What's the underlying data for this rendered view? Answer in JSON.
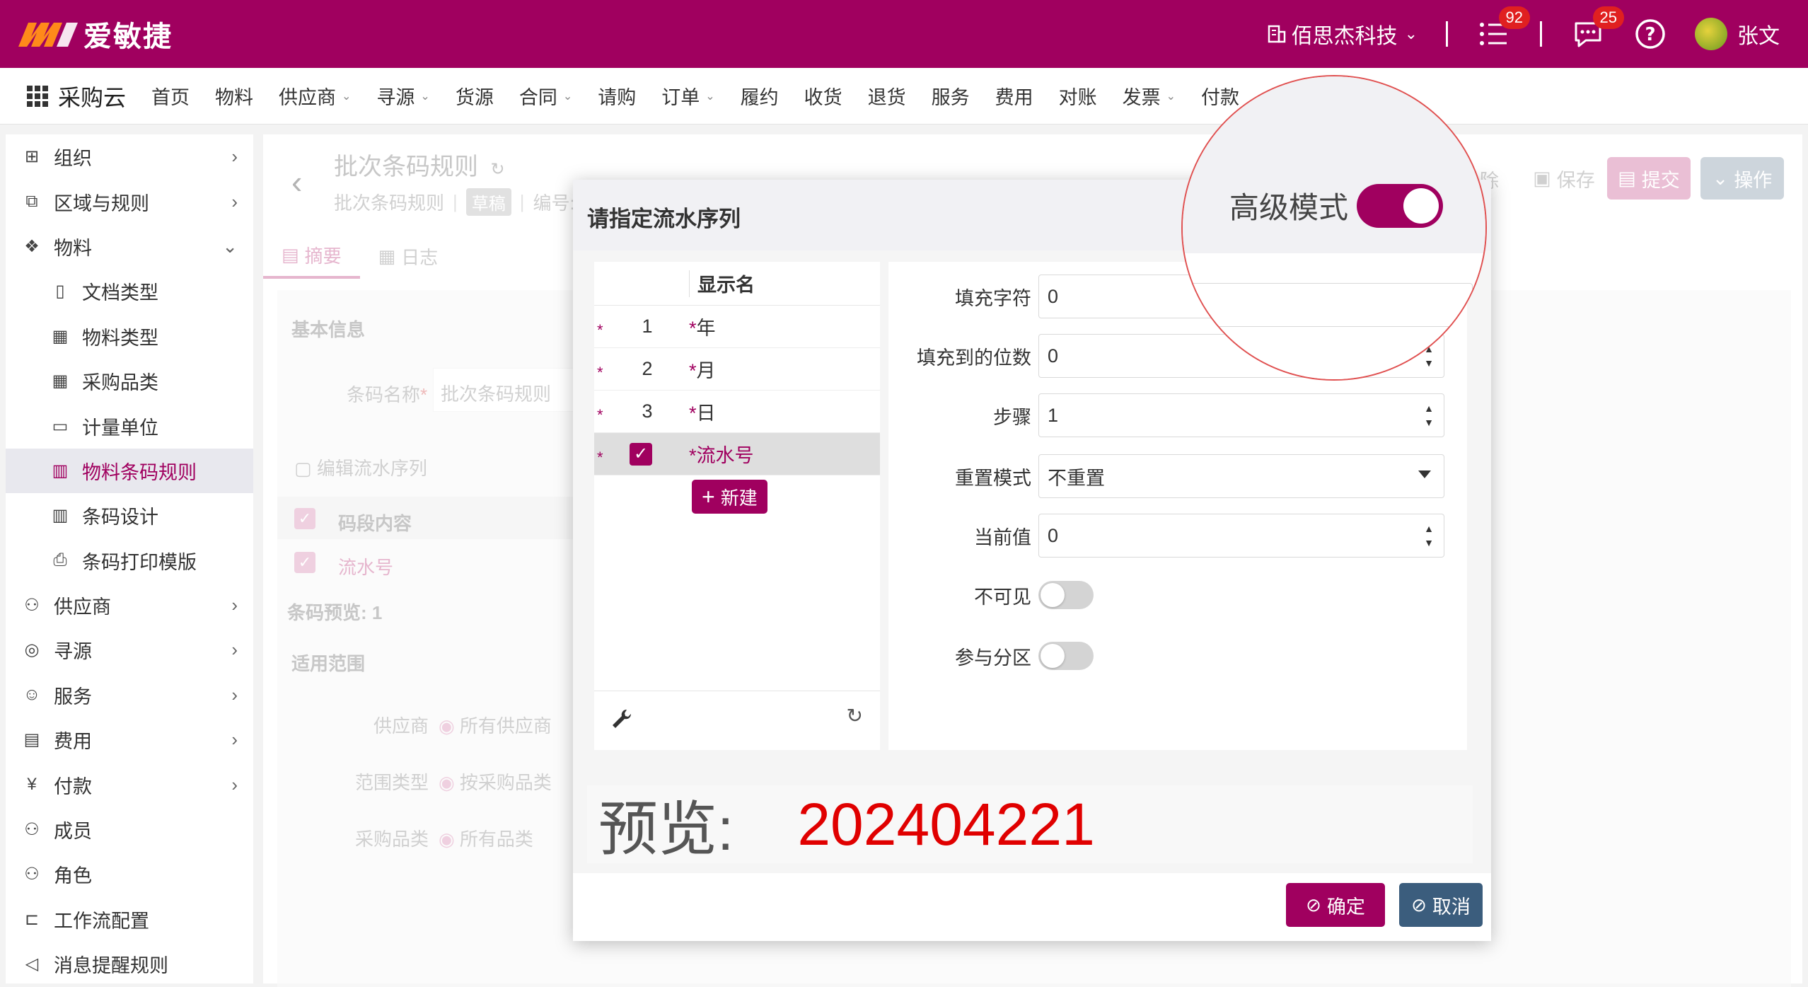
{
  "header": {
    "logo_text": "爱敏捷",
    "company": "佰思杰科技",
    "tasks_badge": "92",
    "messages_badge": "25",
    "user_name": "张文"
  },
  "nav": {
    "app_name": "采购云",
    "items": [
      {
        "label": "首页",
        "dropdown": false
      },
      {
        "label": "物料",
        "dropdown": false
      },
      {
        "label": "供应商",
        "dropdown": true
      },
      {
        "label": "寻源",
        "dropdown": true
      },
      {
        "label": "货源",
        "dropdown": false
      },
      {
        "label": "合同",
        "dropdown": true
      },
      {
        "label": "请购",
        "dropdown": false
      },
      {
        "label": "订单",
        "dropdown": true
      },
      {
        "label": "履约",
        "dropdown": false
      },
      {
        "label": "收货",
        "dropdown": false
      },
      {
        "label": "退货",
        "dropdown": false
      },
      {
        "label": "服务",
        "dropdown": false
      },
      {
        "label": "费用",
        "dropdown": false
      },
      {
        "label": "对账",
        "dropdown": false
      },
      {
        "label": "发票",
        "dropdown": true
      },
      {
        "label": "付款",
        "dropdown": false
      }
    ]
  },
  "sidebar": {
    "items": [
      {
        "label": "组织",
        "icon": "org-icon",
        "glyph": "⊞",
        "level": 1,
        "arrow": "›"
      },
      {
        "label": "区域与规则",
        "icon": "region-icon",
        "glyph": "⧉",
        "level": 1,
        "arrow": "›"
      },
      {
        "label": "物料",
        "icon": "material-icon",
        "glyph": "❖",
        "level": 1,
        "arrow": "⌄"
      },
      {
        "label": "文档类型",
        "icon": "document-icon",
        "glyph": "▯",
        "level": 2,
        "arrow": ""
      },
      {
        "label": "物料类型",
        "icon": "material-type-icon",
        "glyph": "▦",
        "level": 2,
        "arrow": ""
      },
      {
        "label": "采购品类",
        "icon": "category-icon",
        "glyph": "▦",
        "level": 2,
        "arrow": ""
      },
      {
        "label": "计量单位",
        "icon": "unit-icon",
        "glyph": "▭",
        "level": 2,
        "arrow": ""
      },
      {
        "label": "物料条码规则",
        "icon": "barcode-icon",
        "glyph": "▥",
        "level": 2,
        "arrow": "",
        "active": true
      },
      {
        "label": "条码设计",
        "icon": "barcode-design-icon",
        "glyph": "▥",
        "level": 2,
        "arrow": ""
      },
      {
        "label": "条码打印模版",
        "icon": "printer-icon",
        "glyph": "⎙",
        "level": 2,
        "arrow": ""
      },
      {
        "label": "供应商",
        "icon": "supplier-icon",
        "glyph": "⚇",
        "level": 1,
        "arrow": "›"
      },
      {
        "label": "寻源",
        "icon": "sourcing-icon",
        "glyph": "◎",
        "level": 1,
        "arrow": "›"
      },
      {
        "label": "服务",
        "icon": "service-icon",
        "glyph": "☺",
        "level": 1,
        "arrow": "›"
      },
      {
        "label": "费用",
        "icon": "expense-icon",
        "glyph": "▤",
        "level": 1,
        "arrow": "›"
      },
      {
        "label": "付款",
        "icon": "payment-icon",
        "glyph": "¥",
        "level": 1,
        "arrow": "›"
      },
      {
        "label": "成员",
        "icon": "member-icon",
        "glyph": "⚇",
        "level": 1,
        "arrow": ""
      },
      {
        "label": "角色",
        "icon": "role-icon",
        "glyph": "⚇",
        "level": 1,
        "arrow": ""
      },
      {
        "label": "工作流配置",
        "icon": "workflow-icon",
        "glyph": "⊏",
        "level": 1,
        "arrow": ""
      },
      {
        "label": "消息提醒规则",
        "icon": "notify-icon",
        "glyph": "◁",
        "level": 1,
        "arrow": ""
      }
    ]
  },
  "document": {
    "title": "批次条码规则",
    "breadcrumb": "批次条码规则",
    "status": "草稿",
    "code_label": "编号:",
    "delete_label": "除",
    "save_label": "保存",
    "submit_label": "提交",
    "actions_label": "操作",
    "tabs": [
      "摘要",
      "日志"
    ],
    "basic_info": "基本信息",
    "barcode_name_label": "条码名称",
    "barcode_name_value": "批次条码规则",
    "edit_sequence": "编辑流水序列",
    "segment_header": "码段内容",
    "segment_row": "流水号",
    "barcode_preview": "条码预览: 1",
    "scope": "适用范围",
    "supplier_label": "供应商",
    "supplier_value": "所有供应商",
    "scope_type_label": "范围类型",
    "scope_type_value": "按采购品类",
    "category_label": "采购品类",
    "category_value": "所有品类"
  },
  "dialog": {
    "title": "请指定流水序列",
    "advanced_mode_label": "高级模式",
    "advanced_mode_on": true,
    "list_header": "显示名",
    "rows": [
      {
        "num": "1",
        "name": "年",
        "selected": false
      },
      {
        "num": "2",
        "name": "月",
        "selected": false
      },
      {
        "num": "3",
        "name": "日",
        "selected": false
      },
      {
        "num": "",
        "name": "流水号",
        "selected": true
      }
    ],
    "new_button": "新建",
    "form": {
      "fill_char_label": "填充字符",
      "fill_char_value": "0",
      "fill_to_label": "填充到的位数",
      "fill_to_value": "0",
      "step_label": "步骤",
      "step_value": "1",
      "reset_mode_label": "重置模式",
      "reset_mode_value": "不重置",
      "current_label": "当前值",
      "current_value": "0",
      "invisible_label": "不可见",
      "partition_label": "参与分区"
    },
    "preview_label": "预览:",
    "preview_value": "202404221",
    "ok_label": "确定",
    "cancel_label": "取消"
  },
  "colors": {
    "brand": "#a0005f",
    "header_bg": "#a0005f",
    "preview_value": "#e00000",
    "cancel_bg": "#3b5d7d"
  }
}
